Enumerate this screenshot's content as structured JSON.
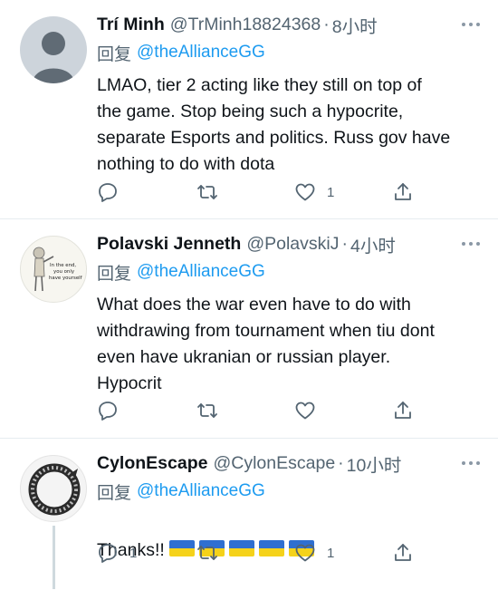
{
  "tweets": [
    {
      "name": "Trí Minh",
      "handle": "@TrMinh18824368",
      "dot": "·",
      "time": "8小时",
      "reply_prefix": "回复",
      "reply_to": "@theAllianceGG",
      "text": "LMAO, tier 2 acting like they still on top of\nthe game. Stop being such a hypocrite,\nseparate Esports and politics. Russ gov have\nnothing to do with dota",
      "reply_count": "",
      "like_count": "1"
    },
    {
      "name": "Polavski Jenneth",
      "handle": "@PolavskiJ",
      "dot": "·",
      "time": "4小时",
      "reply_prefix": "回复",
      "reply_to": "@theAllianceGG",
      "avatar_caption": "In the end, you only have yourself",
      "text": "What does the war even have to do with\nwithdrawing from tournament when tiu dont\neven have ukranian or russian player.\nHypocrit",
      "reply_count": "",
      "like_count": ""
    },
    {
      "name": "CylonEscape",
      "handle": "@CylonEscape",
      "dot": "·",
      "time": "10小时",
      "reply_prefix": "回复",
      "reply_to": "@theAllianceGG",
      "text": "Thanks!!",
      "flag_count": 5,
      "reply_count": "1",
      "like_count": "1"
    }
  ],
  "colors": {
    "text": "#0f1419",
    "secondary": "#536471",
    "link": "#1d9bf0",
    "icon": "#536471",
    "divider": "#e6ecf0",
    "flag_blue": "#2f6fd0",
    "flag_yellow": "#f5d21a"
  },
  "icons": [
    "more-icon",
    "reply-icon",
    "retweet-icon",
    "like-icon",
    "share-icon"
  ]
}
